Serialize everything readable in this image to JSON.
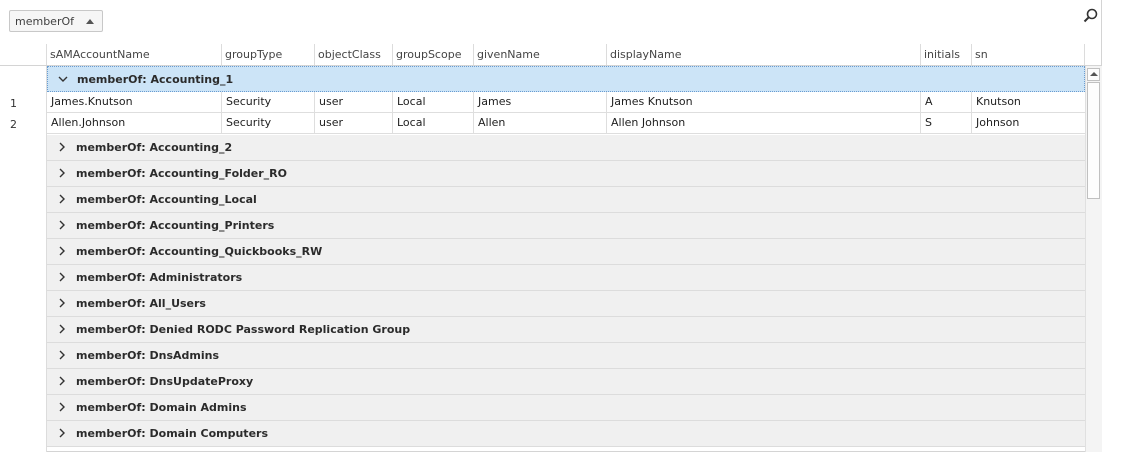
{
  "group_panel": {
    "group_by_label": "memberOf"
  },
  "columns": {
    "samaccountname": "sAMAccountName",
    "grouptype": "groupType",
    "objectclass": "objectClass",
    "groupscope": "groupScope",
    "givenname": "givenName",
    "displayname": "displayName",
    "initials": "initials",
    "sn": "sn"
  },
  "expanded_group": {
    "label": "memberOf: Accounting_1",
    "rows": [
      {
        "num": "1",
        "samaccountname": "James.Knutson",
        "grouptype": "Security",
        "objectclass": "user",
        "groupscope": "Local",
        "givenname": "James",
        "displayname": "James Knutson",
        "initials": "A",
        "sn": "Knutson"
      },
      {
        "num": "2",
        "samaccountname": "Allen.Johnson",
        "grouptype": "Security",
        "objectclass": "user",
        "groupscope": "Local",
        "givenname": "Allen",
        "displayname": "Allen Johnson",
        "initials": "S",
        "sn": "Johnson"
      }
    ]
  },
  "collapsed_groups": [
    "memberOf: Accounting_2",
    "memberOf: Accounting_Folder_RO",
    "memberOf: Accounting_Local",
    "memberOf: Accounting_Printers",
    "memberOf: Accounting_Quickbooks_RW",
    "memberOf: Administrators",
    "memberOf: All_Users",
    "memberOf: Denied RODC Password Replication Group",
    "memberOf: DnsAdmins",
    "memberOf: DnsUpdateProxy",
    "memberOf: Domain Admins",
    "memberOf: Domain Computers"
  ],
  "icons": {
    "search": "search-icon",
    "expanded": "chevron-down-icon",
    "collapsed": "chevron-right-icon",
    "sort": "sort-ascending-icon"
  },
  "colors": {
    "selected_group_bg": "#cce4f7",
    "group_bg": "#f0f0f0"
  }
}
